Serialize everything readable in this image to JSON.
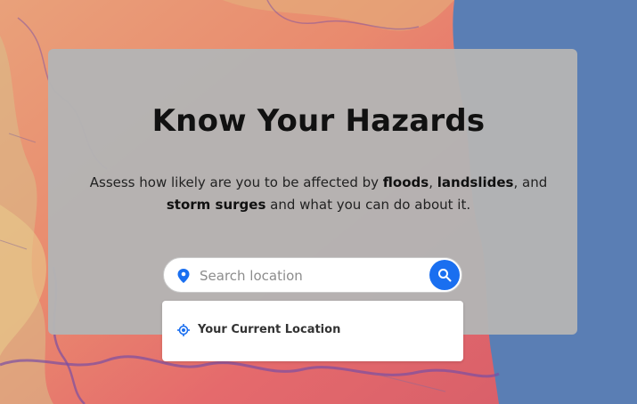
{
  "hero": {
    "title": "Know Your Hazards",
    "desc_1": "Assess how likely are you to be affected by ",
    "kw_floods": "floods",
    "sep_1": ", ",
    "kw_landslides": "landslides",
    "sep_2": ", and ",
    "kw_storm": "storm surges",
    "desc_2": " and what you can do about it."
  },
  "search": {
    "placeholder": "Search location",
    "value": ""
  },
  "dropdown": {
    "current_location_label": "Your Current Location"
  },
  "icons": {
    "pin": "map-pin-icon",
    "search": "search-icon",
    "locate": "crosshair-location-icon"
  },
  "colors": {
    "accent": "#1a6ff0",
    "sea": "#5a7eb4",
    "card": "#b4b4b4"
  }
}
